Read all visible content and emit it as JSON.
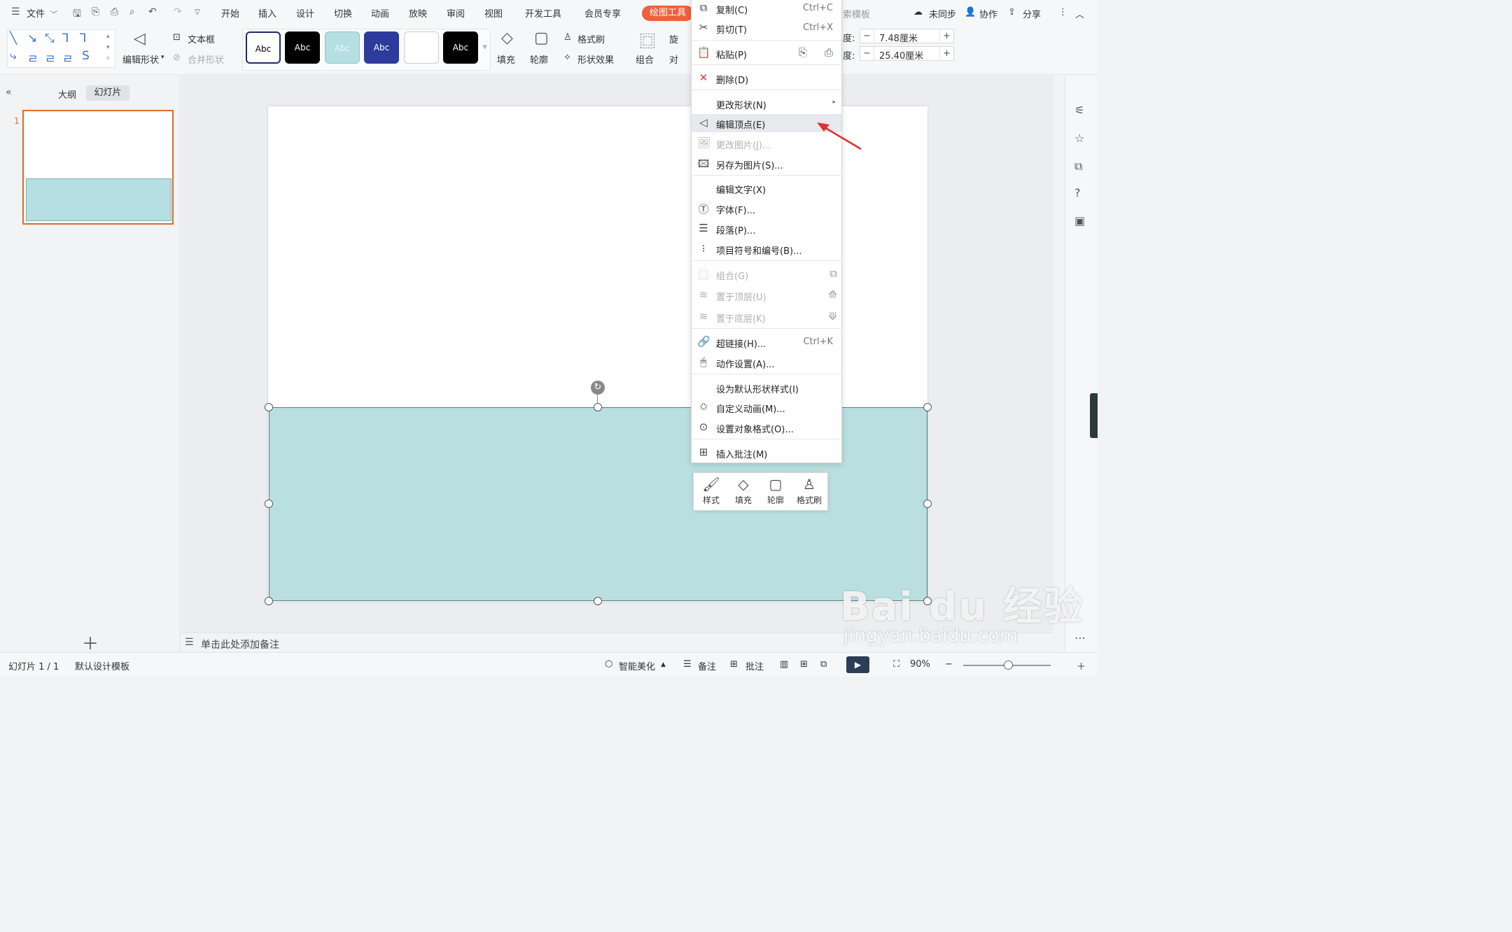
{
  "menubar": {
    "file": "文件",
    "tabs": [
      "开始",
      "插入",
      "设计",
      "切换",
      "动画",
      "放映",
      "审阅",
      "视图",
      "开发工具",
      "会员专享"
    ],
    "context_tab": "绘图工具",
    "search_hint": "索模板",
    "unsynced": "未同步",
    "collab": "协作",
    "share": "分享"
  },
  "ribbon": {
    "edit_shape": "编辑形状",
    "textbox": "文本框",
    "merge_shape": "合并形状",
    "style_sample": "Abc",
    "fill": "填充",
    "outline": "轮廓",
    "format_painter": "格式刷",
    "shape_effects": "形状效果",
    "group": "组合",
    "rotate": "旋",
    "align": "对",
    "height_label": "度:",
    "height_value": "7.48厘米",
    "width_label": "度:",
    "width_value": "25.40厘米"
  },
  "leftpanel": {
    "tab_outline": "大纲",
    "tab_slides": "幻灯片",
    "slide_number": "1"
  },
  "notes": {
    "placeholder": "单击此处添加备注"
  },
  "context_menu": {
    "copy": {
      "label": "复制(C)",
      "shortcut": "Ctrl+C"
    },
    "cut": {
      "label": "剪切(T)",
      "shortcut": "Ctrl+X"
    },
    "paste": {
      "label": "粘贴(P)"
    },
    "delete": {
      "label": "删除(D)"
    },
    "change_shape": {
      "label": "更改形状(N)"
    },
    "edit_points": {
      "label": "编辑顶点(E)"
    },
    "change_picture": {
      "label": "更改图片(J)..."
    },
    "save_as_picture": {
      "label": "另存为图片(S)..."
    },
    "edit_text": {
      "label": "编辑文字(X)"
    },
    "font": {
      "label": "字体(F)..."
    },
    "paragraph": {
      "label": "段落(P)..."
    },
    "bullets": {
      "label": "项目符号和编号(B)..."
    },
    "group": {
      "label": "组合(G)"
    },
    "bring_front": {
      "label": "置于顶层(U)"
    },
    "send_back": {
      "label": "置于底层(K)"
    },
    "hyperlink": {
      "label": "超链接(H)...",
      "shortcut": "Ctrl+K"
    },
    "action": {
      "label": "动作设置(A)..."
    },
    "set_default": {
      "label": "设为默认形状样式(I)"
    },
    "custom_anim": {
      "label": "自定义动画(M)..."
    },
    "format_object": {
      "label": "设置对象格式(O)..."
    },
    "insert_comment": {
      "label": "插入批注(M)"
    }
  },
  "mini_toolbar": {
    "style": "样式",
    "fill": "填充",
    "outline": "轮廓",
    "painter": "格式刷"
  },
  "status": {
    "slide_info": "幻灯片 1 / 1",
    "template": "默认设计模板",
    "smart": "智能美化",
    "notes": "备注",
    "comment": "批注",
    "zoom": "90%"
  },
  "watermark": {
    "brand": "Bai du 经验",
    "url": "jingyan.baidu.com"
  },
  "colors": {
    "accent": "#f0603c",
    "shape_fill": "#b9dfe1",
    "selection": "#e06a2b"
  }
}
